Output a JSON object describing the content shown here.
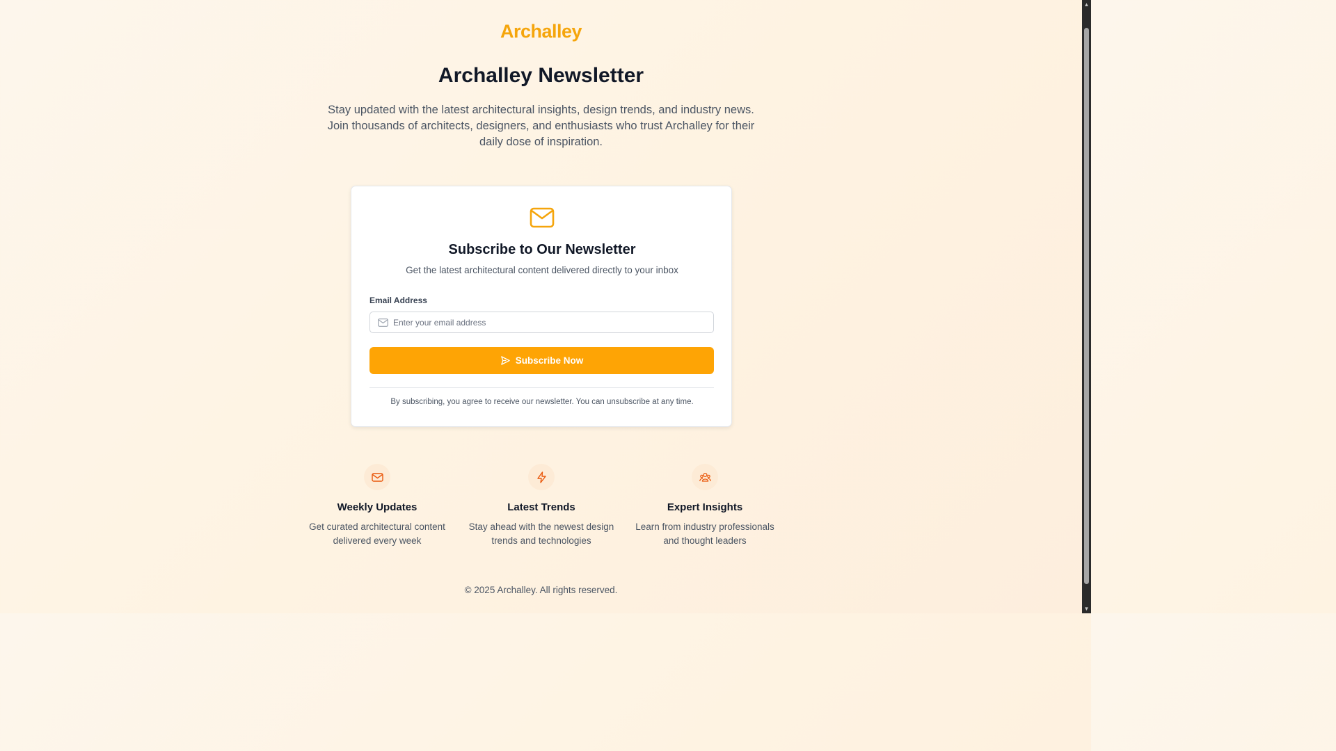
{
  "brand": {
    "logo_text": "Archalley",
    "accent_color": "#fea405"
  },
  "header": {
    "title": "Archalley Newsletter",
    "intro": "Stay updated with the latest architectural insights, design trends, and industry news. Join thousands of architects, designers, and enthusiasts who trust Archalley for their daily dose of inspiration."
  },
  "card": {
    "icon": "mail-icon",
    "title": "Subscribe to Our Newsletter",
    "subtitle": "Get the latest architectural content delivered directly to your inbox",
    "email_label": "Email Address",
    "email_placeholder": "Enter your email address",
    "email_value": "",
    "button_label": "Subscribe Now",
    "button_icon": "send-icon",
    "terms": "By subscribing, you agree to receive our newsletter. You can unsubscribe at any time."
  },
  "features": [
    {
      "icon": "mail-icon",
      "title": "Weekly Updates",
      "description": "Get curated architectural content delivered every week"
    },
    {
      "icon": "lightning-icon",
      "title": "Latest Trends",
      "description": "Stay ahead with the newest design trends and technologies"
    },
    {
      "icon": "users-icon",
      "title": "Expert Insights",
      "description": "Learn from industry professionals and thought leaders"
    }
  ],
  "footer": {
    "copyright": "© 2025 Archalley. All rights reserved."
  }
}
